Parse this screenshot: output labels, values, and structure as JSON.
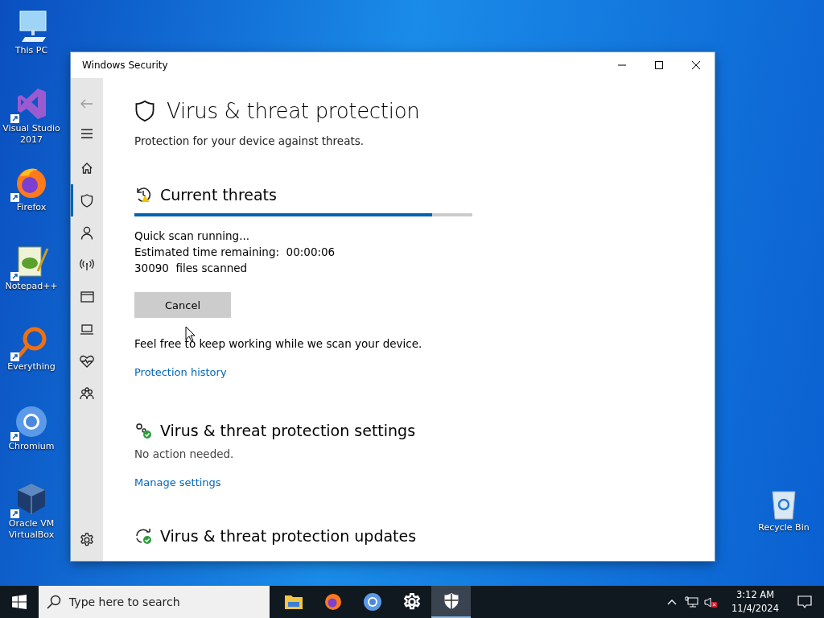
{
  "desktop_icons": [
    {
      "label": "This PC",
      "kind": "pc"
    },
    {
      "label": "Visual Studio 2017",
      "kind": "vs"
    },
    {
      "label": "Firefox",
      "kind": "firefox"
    },
    {
      "label": "Notepad++",
      "kind": "notepad"
    },
    {
      "label": "Everything",
      "kind": "search"
    },
    {
      "label": "Chromium",
      "kind": "chromium"
    },
    {
      "label": "Oracle VM VirtualBox",
      "kind": "box"
    },
    {
      "label": "Recycle Bin",
      "kind": "recycle"
    }
  ],
  "window": {
    "title": "Windows Security",
    "nav": [
      {
        "kind": "menu",
        "selected": false
      },
      {
        "kind": "home",
        "selected": false
      },
      {
        "kind": "shield",
        "selected": true
      },
      {
        "kind": "person",
        "selected": false
      },
      {
        "kind": "antenna",
        "selected": false
      },
      {
        "kind": "browser",
        "selected": false
      },
      {
        "kind": "laptop",
        "selected": false
      },
      {
        "kind": "heart",
        "selected": false
      },
      {
        "kind": "family",
        "selected": false
      },
      {
        "kind": "gear",
        "selected": false
      }
    ],
    "page": {
      "title": "Virus & threat protection",
      "subtitle": "Protection for your device against threats.",
      "current_threats": {
        "heading": "Current threats",
        "level": 0.88,
        "lines": [
          "Quick scan running...",
          "Estimated time remaining:  00:00:06",
          "30090  files scanned"
        ],
        "button": "Cancel",
        "note": "Feel free to keep working while we scan your device.",
        "link": "Protection history"
      },
      "sections": [
        {
          "heading": "Virus & threat protection settings",
          "kind": "settings",
          "status": "No action needed.",
          "link": "Manage settings"
        },
        {
          "heading": "Virus & threat protection updates",
          "kind": "updates"
        }
      ]
    }
  },
  "taskbar": {
    "search": {
      "placeholder": "Type here to search"
    },
    "apps": [
      {
        "kind": "folder",
        "selected": false
      },
      {
        "kind": "firefox",
        "selected": false
      },
      {
        "kind": "chromium",
        "selected": false
      },
      {
        "kind": "gear",
        "selected": false
      },
      {
        "kind": "shield",
        "selected": true
      }
    ],
    "time": "3:12 AM",
    "date": "11/4/2024"
  }
}
